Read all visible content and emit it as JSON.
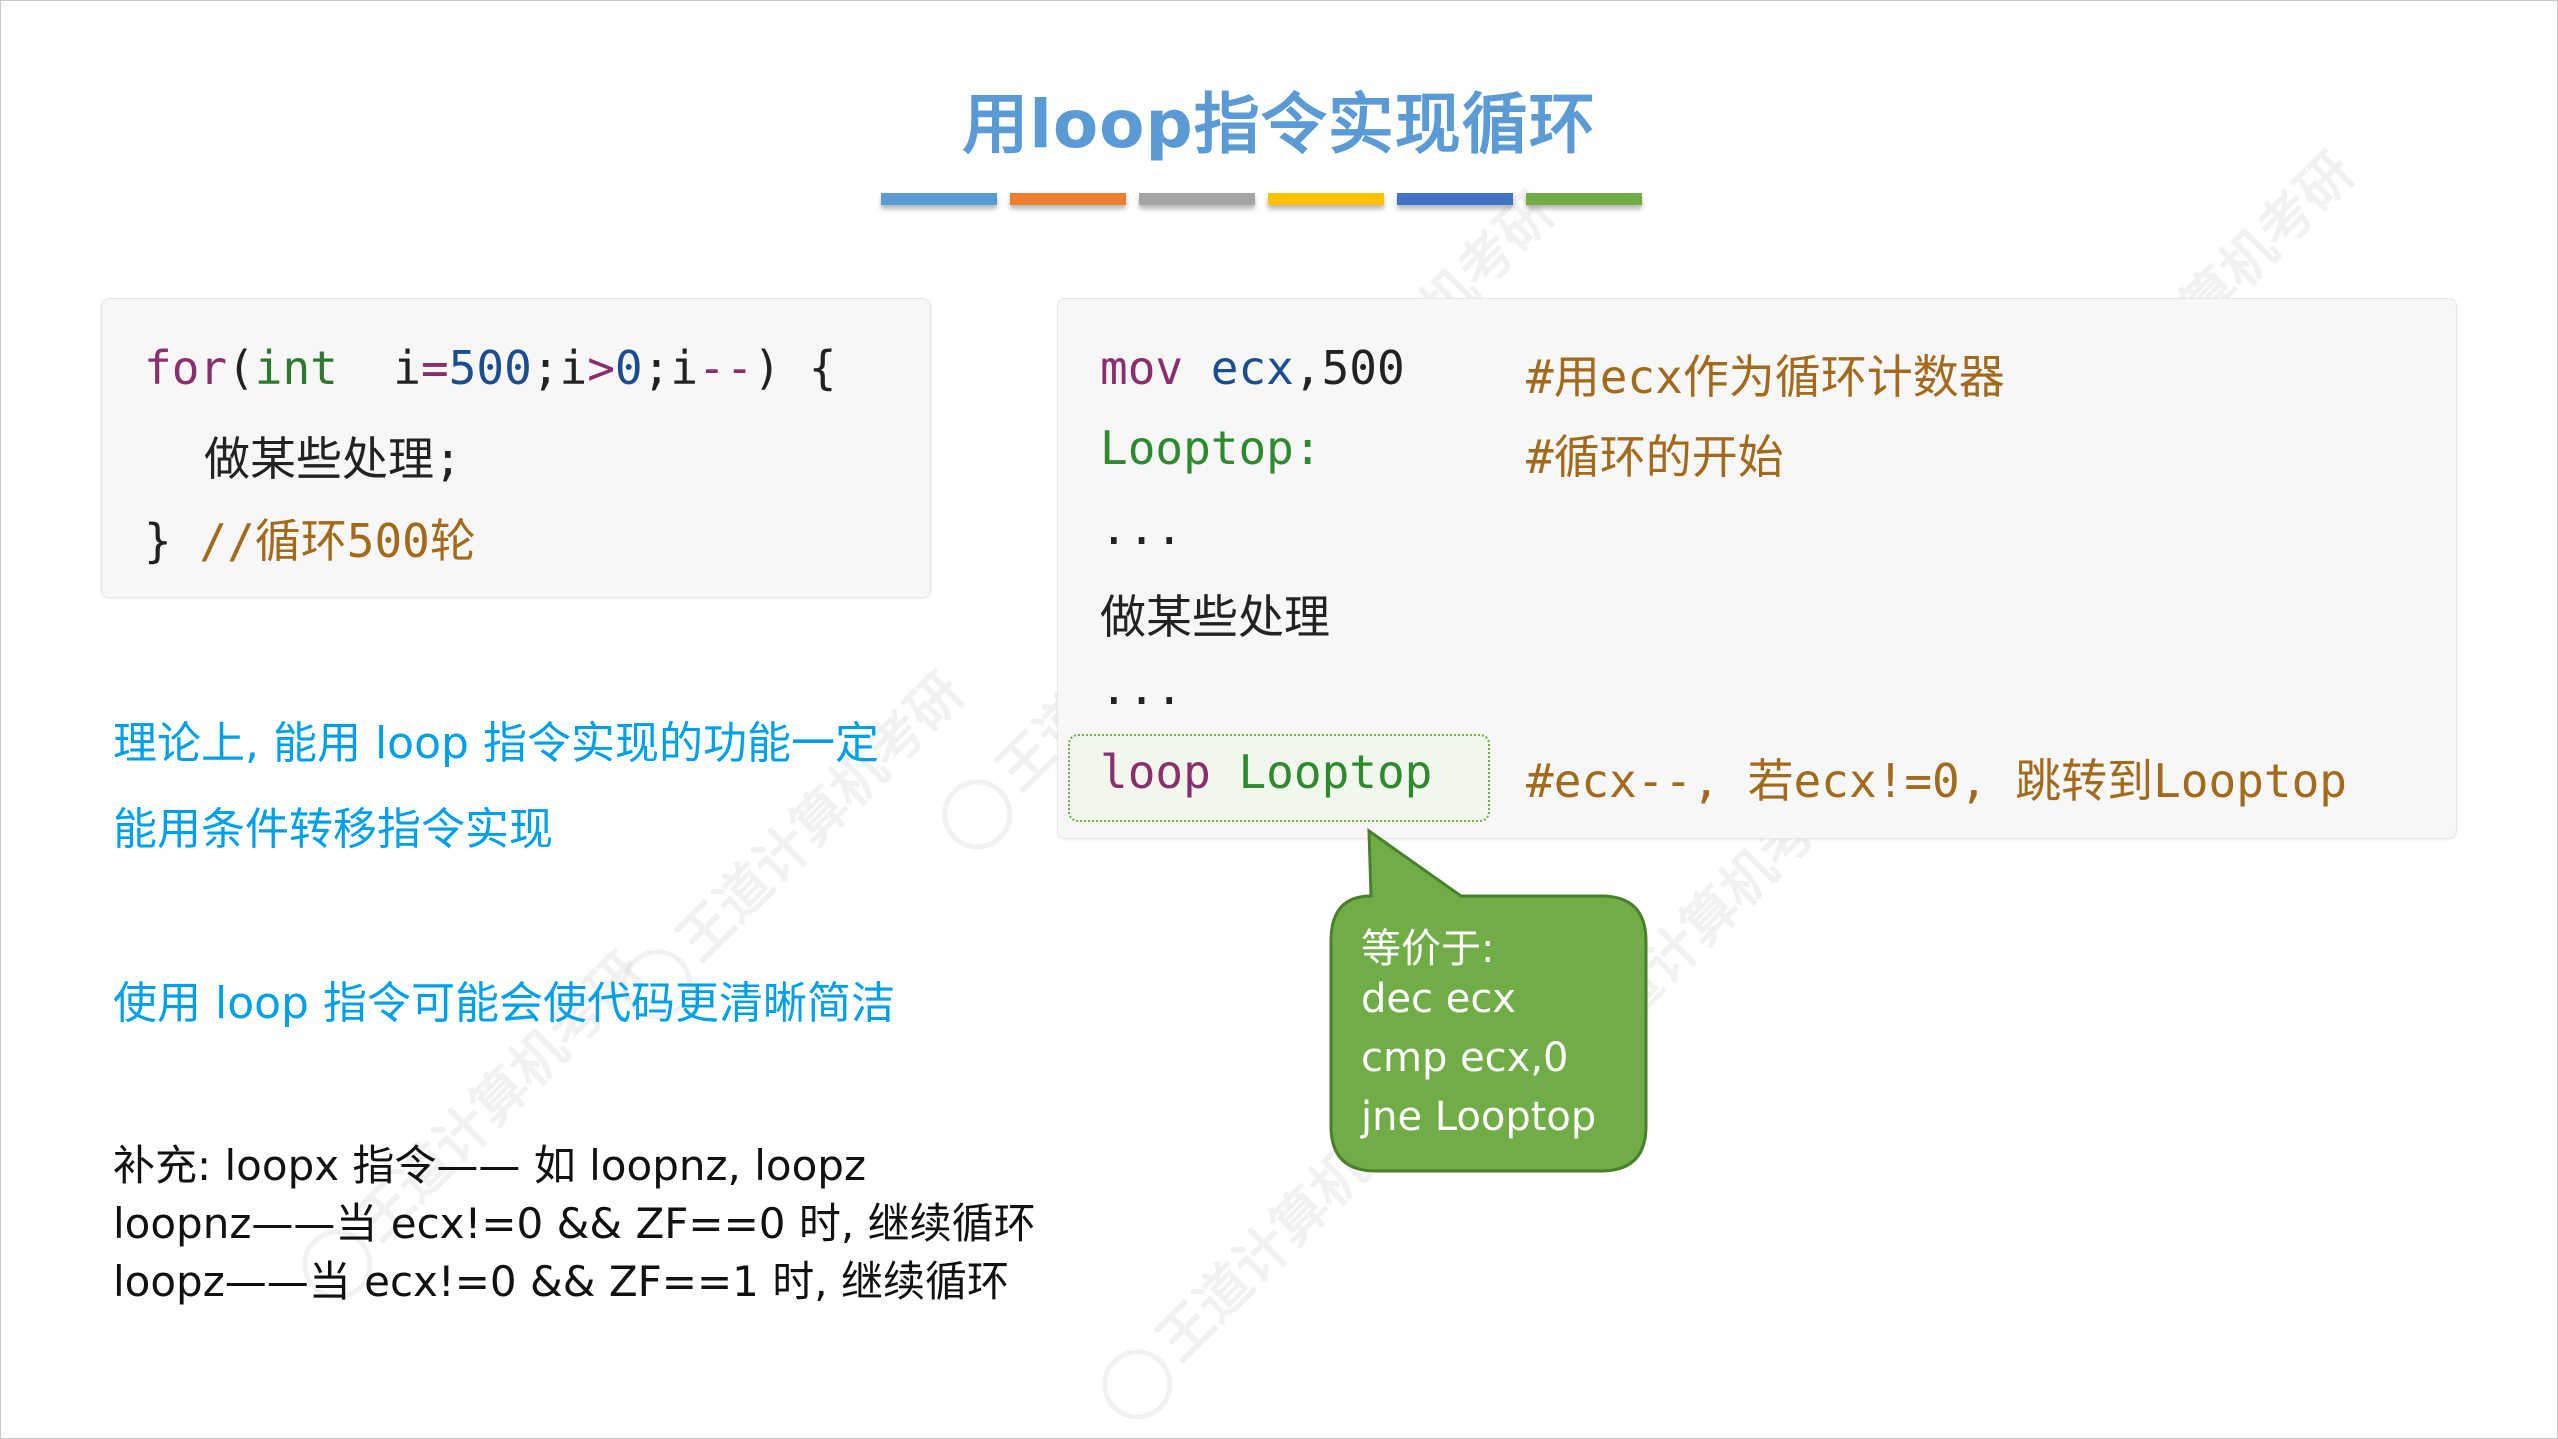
{
  "title": "用loop指令实现循环",
  "colors": {
    "title": "#5b9bd5",
    "bars": [
      "#5b9bd5",
      "#ed7d31",
      "#a5a5a5",
      "#ffc000",
      "#4472c4",
      "#70ad47"
    ],
    "info_text": "#00a0e9",
    "callout_fill": "#70ad47"
  },
  "left_code": {
    "line1": {
      "kw_for": "for",
      "paren_open": "(",
      "kw_int": "int",
      "sp": " ",
      "var_i": "i",
      "eq": "=",
      "num500": "500",
      "semi1": ";",
      "cond_i": "i",
      "gt": ">",
      "zero": "0",
      "semi2": ";",
      "dec_i": "i",
      "minus": "--",
      "paren_close": ")",
      "brace_open": " {"
    },
    "line2": "做某些处理;",
    "line3_brace": "}",
    "line3_comment": "//循环500轮"
  },
  "right_code": {
    "row1": {
      "instr": "mov",
      "reg": "ecx",
      "sep": ",",
      "num": "500",
      "comment": "#用ecx作为循环计数器"
    },
    "row2": {
      "label": "Looptop:",
      "comment": "#循环的开始"
    },
    "row3": "...",
    "row4": "做某些处理",
    "row5": "...",
    "row6": {
      "instr": "loop",
      "target": "Looptop",
      "comment": "#ecx--, 若ecx!=0, 跳转到Looptop"
    }
  },
  "callout": {
    "title": "等价于:",
    "lines": [
      "dec ecx",
      "cmp ecx,0",
      "jne Looptop"
    ]
  },
  "info": {
    "theory_line1": "理论上, 能用 loop 指令实现的功能一定",
    "theory_line2": "能用条件转移指令实现",
    "usage": "使用 loop 指令可能会使代码更清晰简洁",
    "supplement_1": "补充: loopx 指令—— 如 loopnz, loopz",
    "supplement_2": "loopnz——当 ecx!=0 && ZF==0 时, 继续循环",
    "supplement_3": "loopz——当 ecx!=0 && ZF==1 时, 继续循环"
  },
  "watermark": "王道计算机考研"
}
